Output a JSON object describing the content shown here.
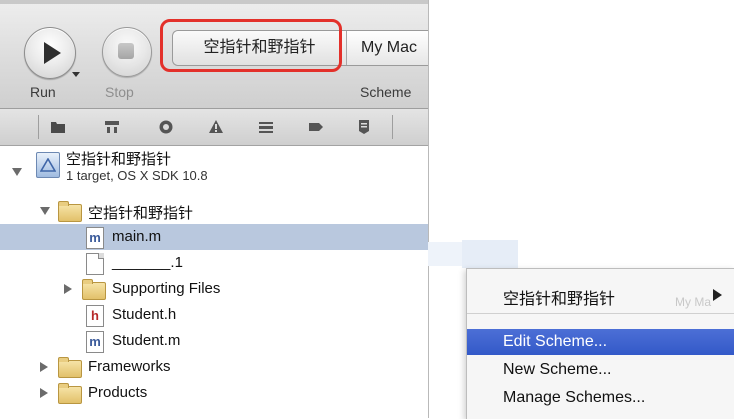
{
  "toolbar": {
    "run_label": "Run",
    "stop_label": "Stop",
    "scheme_label": "Scheme",
    "scheme_name": "空指针和野指针",
    "destination": "My Mac"
  },
  "navigator": {
    "icons": [
      "folder-icon",
      "symbol-icon",
      "search-icon",
      "warning-icon",
      "test-icon",
      "breakpoint-icon",
      "log-icon"
    ]
  },
  "tree": {
    "project": {
      "name": "空指针和野指针",
      "subtitle": "1 target, OS X SDK 10.8"
    },
    "items": [
      {
        "label": "空指针和野指针",
        "kind": "folder",
        "disclosure": "open"
      },
      {
        "label": "main.m",
        "kind": "m",
        "selected": true
      },
      {
        "label": "_______.1",
        "kind": "blank"
      },
      {
        "label": "Supporting Files",
        "kind": "folder",
        "disclosure": "closed"
      },
      {
        "label": "Student.h",
        "kind": "h"
      },
      {
        "label": "Student.m",
        "kind": "m"
      },
      {
        "label": "Frameworks",
        "kind": "folder",
        "disclosure": "closed"
      },
      {
        "label": "Products",
        "kind": "folder",
        "disclosure": "closed"
      }
    ]
  },
  "scheme_menu": {
    "items": [
      {
        "label": "空指针和野指针",
        "has_submenu": true,
        "ghost": "My Ma"
      },
      {
        "label": "Edit Scheme...",
        "active": true
      },
      {
        "label": "New Scheme..."
      },
      {
        "label": "Manage Schemes..."
      }
    ]
  },
  "colors": {
    "highlight_box": "#e3302a",
    "selection": "#b9c8de",
    "menu_active": "#3359c8"
  }
}
